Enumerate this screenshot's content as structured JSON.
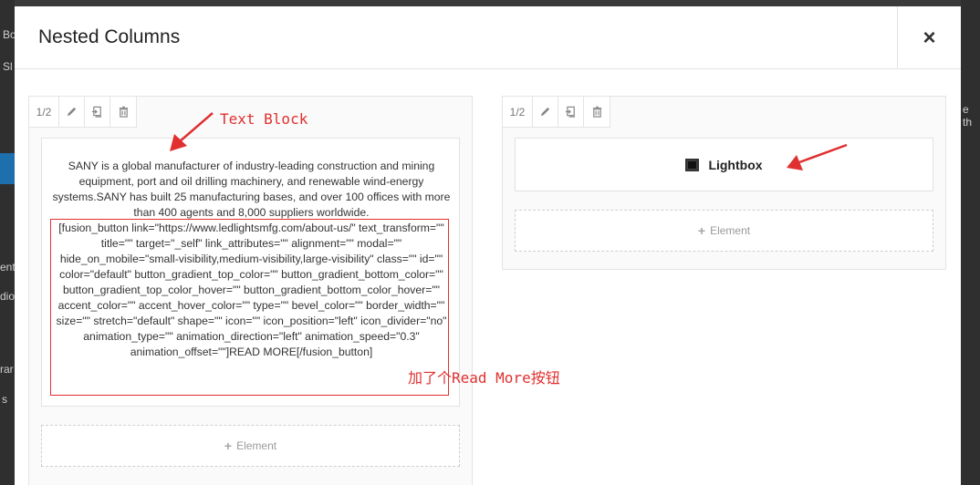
{
  "backdrop": {
    "fragments": [
      "Bo",
      "Sl",
      "ent",
      "dio",
      "rar",
      "s",
      "e th"
    ]
  },
  "modal": {
    "title": "Nested Columns",
    "close_glyph": "×"
  },
  "left_column": {
    "size_label": "1/2",
    "text_block": {
      "paragraph": "SANY is a global manufacturer of industry-leading construction and mining equipment, port and oil drilling machinery, and renewable wind-energy systems.SANY has built 25 manufacturing bases, and over 100 offices with more than 400 agents and 8,000 suppliers worldwide.",
      "shortcode": "[fusion_button link=\"https://www.ledlightsmfg.com/about-us/\" text_transform=\"\" title=\"\" target=\"_self\" link_attributes=\"\" alignment=\"\" modal=\"\" hide_on_mobile=\"small-visibility,medium-visibility,large-visibility\" class=\"\" id=\"\" color=\"default\" button_gradient_top_color=\"\" button_gradient_bottom_color=\"\" button_gradient_top_color_hover=\"\" button_gradient_bottom_color_hover=\"\" accent_color=\"\" accent_hover_color=\"\" type=\"\" bevel_color=\"\" border_width=\"\" size=\"\" stretch=\"default\" shape=\"\" icon=\"\" icon_position=\"left\" icon_divider=\"no\" animation_type=\"\" animation_direction=\"left\" animation_speed=\"0.3\" animation_offset=\"\"]READ MORE[/fusion_button]"
    },
    "add_element_label": "Element"
  },
  "right_column": {
    "size_label": "1/2",
    "lightbox_label": "Lightbox",
    "add_element_label": "Element"
  },
  "annotations": {
    "text_block_label": "Text Block",
    "read_more_label": "加了个Read More按钮",
    "color": "#e03030"
  },
  "icons": [
    "pencil-icon",
    "clone-icon",
    "trash-icon",
    "lightbox-icon",
    "plus-icon",
    "close-icon"
  ]
}
